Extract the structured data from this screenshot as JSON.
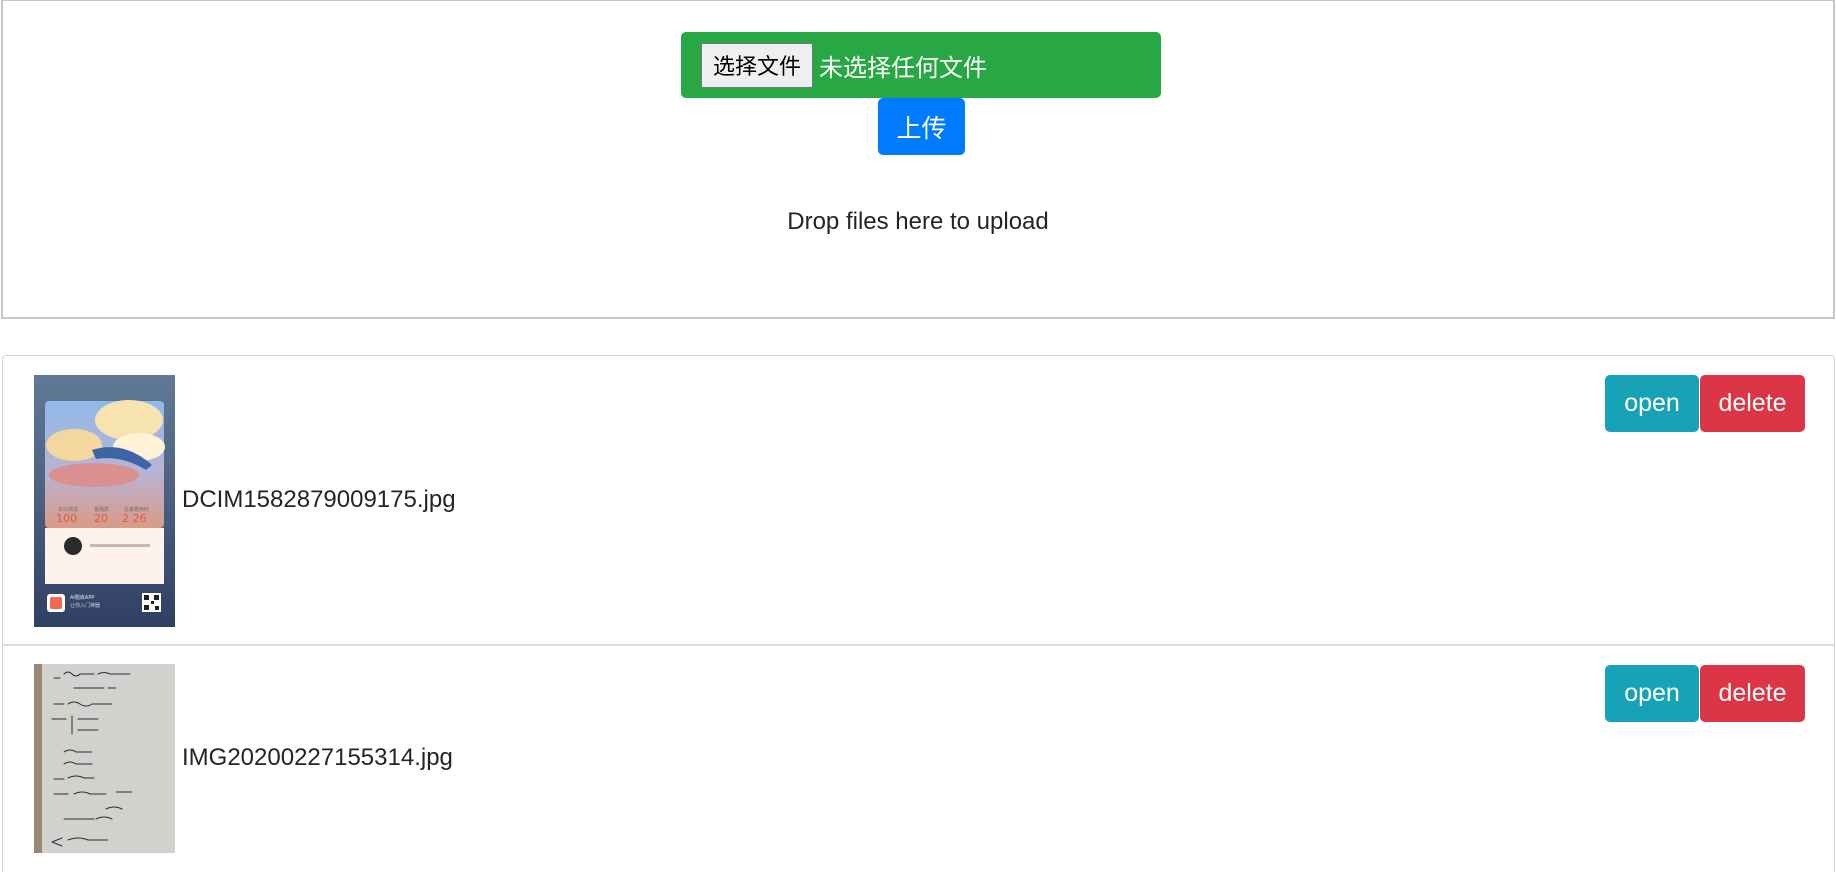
{
  "upload": {
    "choose_label": "选择文件",
    "no_file_label": "未选择任何文件",
    "upload_label": "上传",
    "drop_hint": "Drop files here to upload"
  },
  "files": [
    {
      "name": "DCIM1582879009175.jpg",
      "open_label": "open",
      "delete_label": "delete"
    },
    {
      "name": "IMG20200227155314.jpg",
      "open_label": "open",
      "delete_label": "delete"
    }
  ],
  "thumb1": {
    "stat1_label": "本次测试",
    "stat1_value": "100",
    "stat2_label": "答题数",
    "stat2_value": "20",
    "stat3_label": "总答题用时",
    "stat3_value": "2 26",
    "footer_text": "AI题库APP",
    "footer_sub": "让你入门神器"
  },
  "colors": {
    "green": "#28a745",
    "blue": "#007bff",
    "teal": "#17a2b8",
    "red": "#dc3545"
  }
}
